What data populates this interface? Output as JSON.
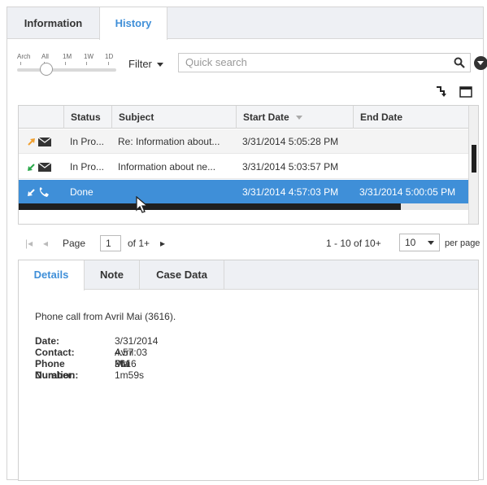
{
  "tabs": {
    "information": "Information",
    "history": "History"
  },
  "range": {
    "labels": [
      "Arch",
      "All",
      "1M",
      "1W",
      "1D"
    ]
  },
  "filter": {
    "label": "Filter"
  },
  "search": {
    "placeholder": "Quick search"
  },
  "grid": {
    "columns": {
      "status": "Status",
      "subject": "Subject",
      "start": "Start Date",
      "end": "End Date"
    },
    "rows": [
      {
        "icons": "outbound-email",
        "status": "In Pro...",
        "subject": "Re: Information about...",
        "start": "3/31/2014 5:05:28 PM",
        "end": ""
      },
      {
        "icons": "inbound-email",
        "status": "In Pro...",
        "subject": "Information about ne...",
        "start": "3/31/2014 5:03:57 PM",
        "end": ""
      },
      {
        "icons": "inbound-call",
        "status": "Done",
        "subject": "",
        "start": "3/31/2014 4:57:03 PM",
        "end": "3/31/2014 5:00:05 PM"
      }
    ]
  },
  "pager": {
    "page_label": "Page",
    "page_value": "1",
    "of_label": "of 1+",
    "range_text": "1 - 10 of 10+",
    "page_size": "10",
    "per_page": "per page"
  },
  "details": {
    "tabs": {
      "details": "Details",
      "note": "Note",
      "case_data": "Case Data"
    },
    "summary": "Phone call from Avril Mai (3616).",
    "fields": [
      {
        "label": "Date:",
        "value": "3/31/2014 4:57:03 PM"
      },
      {
        "label": "Contact:",
        "value": "Avril Mai"
      },
      {
        "label": "Phone Number:",
        "value": "3616"
      },
      {
        "label": "Duration:",
        "value": "1m59s"
      }
    ]
  },
  "colors": {
    "accent": "#3f8fd8",
    "selected_row": "#3f8fd8",
    "outbound": "#f0a030",
    "inbound": "#2aa84a"
  }
}
